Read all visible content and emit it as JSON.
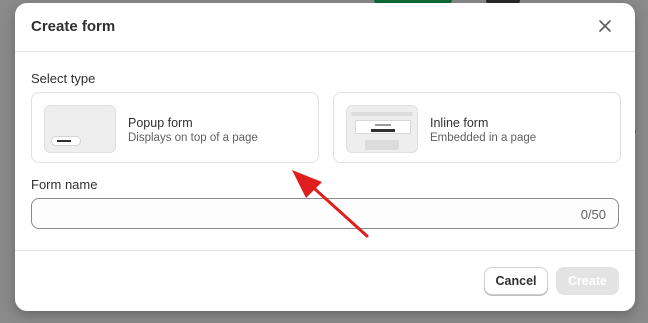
{
  "modal": {
    "title": "Create form",
    "select_type_label": "Select type",
    "form_types": [
      {
        "title": "Popup form",
        "description": "Displays on top of a page"
      },
      {
        "title": "Inline form",
        "description": "Embedded in a page"
      }
    ],
    "form_name_label": "Form name",
    "form_name_value": "",
    "form_name_counter": "0/50",
    "cancel_label": "Cancel",
    "create_label": "Create"
  },
  "annotation": {
    "arrow_color": "#e01e1e"
  },
  "colors": {
    "create_disabled_bg": "#e3e3e3",
    "backdrop": "#8a8a8a"
  },
  "icons": {
    "close": "close-icon",
    "popup_thumb": "popup-form-thumbnail",
    "inline_thumb": "inline-form-thumbnail"
  }
}
